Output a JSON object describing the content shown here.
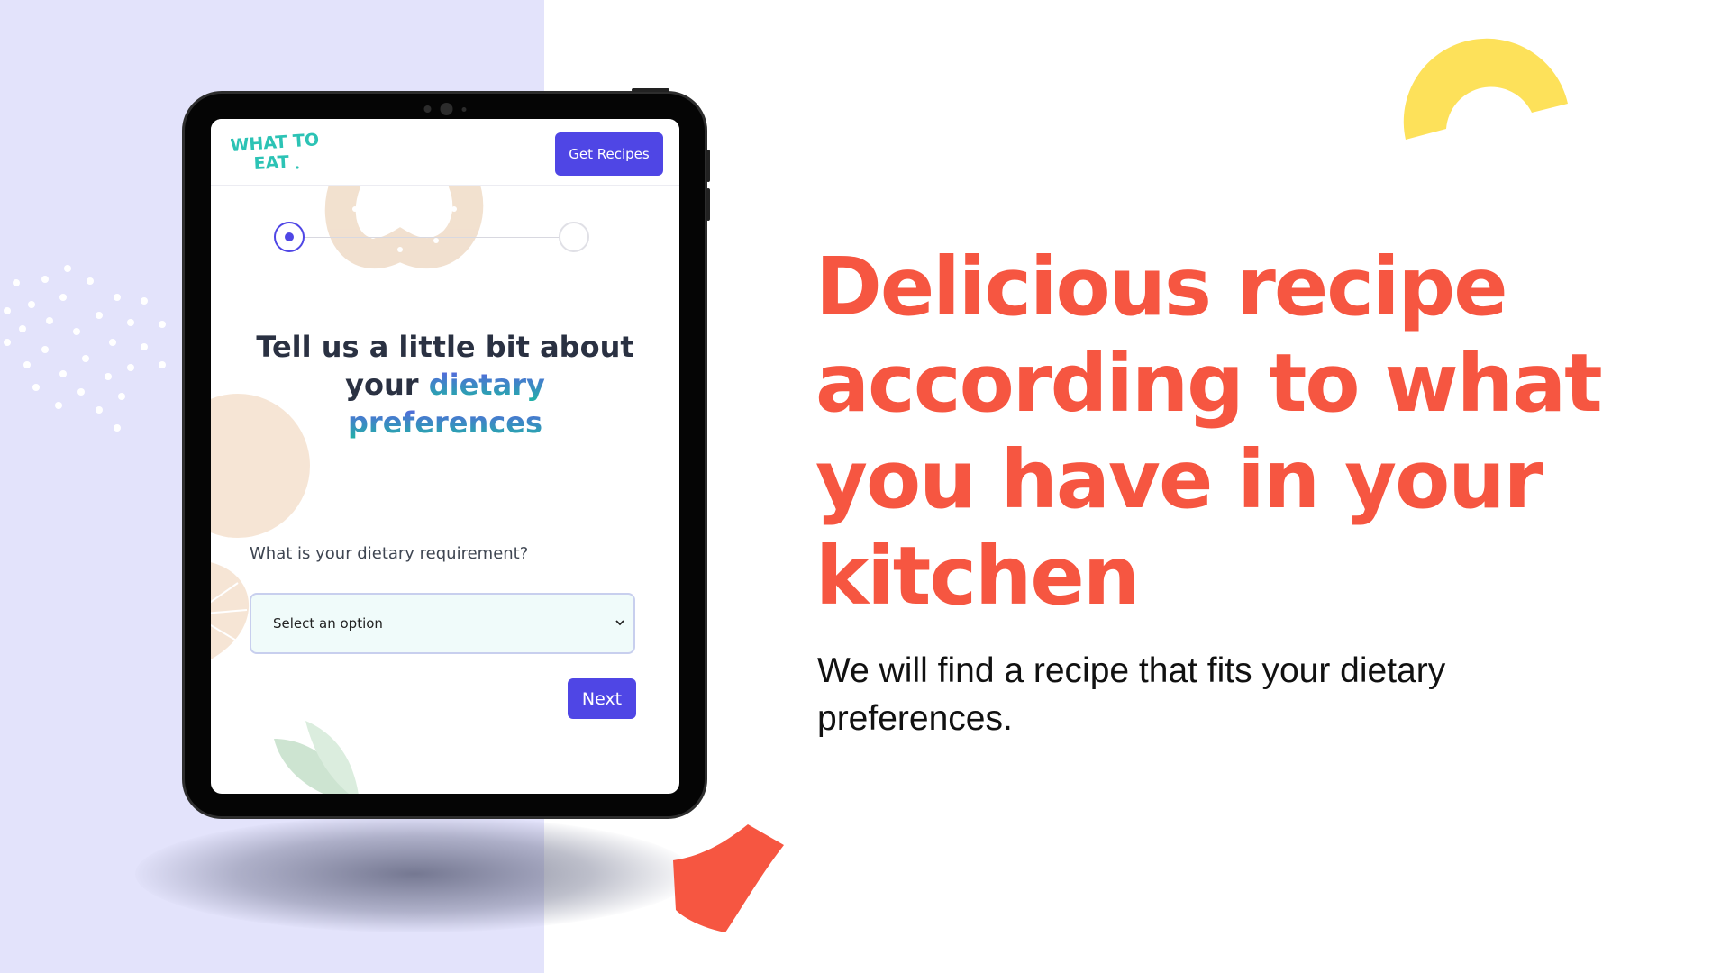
{
  "app": {
    "logo_text": "WHAT TO EAT",
    "header": {
      "get_recipes_label": "Get Recipes"
    },
    "stepper": {
      "current_step": 1,
      "total_steps": 2
    },
    "heading": {
      "line1": "Tell us a little bit about",
      "line2_plain": "your ",
      "line2_highlight": "dietary",
      "line3_highlight": "preferences"
    },
    "form": {
      "question": "What is your dietary requirement?",
      "select_value": "Select an option",
      "next_label": "Next"
    }
  },
  "promo": {
    "title": "Delicious recipe according to what you have in your kitchen",
    "subtitle": "We will find a recipe that fits your dietary preferences."
  },
  "colors": {
    "accent": "#4f46e5",
    "brand_red": "#f65641",
    "left_panel": "#e3e3fb",
    "yellow": "#fde15a",
    "logo_teal": "#2cc3b5"
  },
  "icons": [
    "chevron-down-icon"
  ]
}
